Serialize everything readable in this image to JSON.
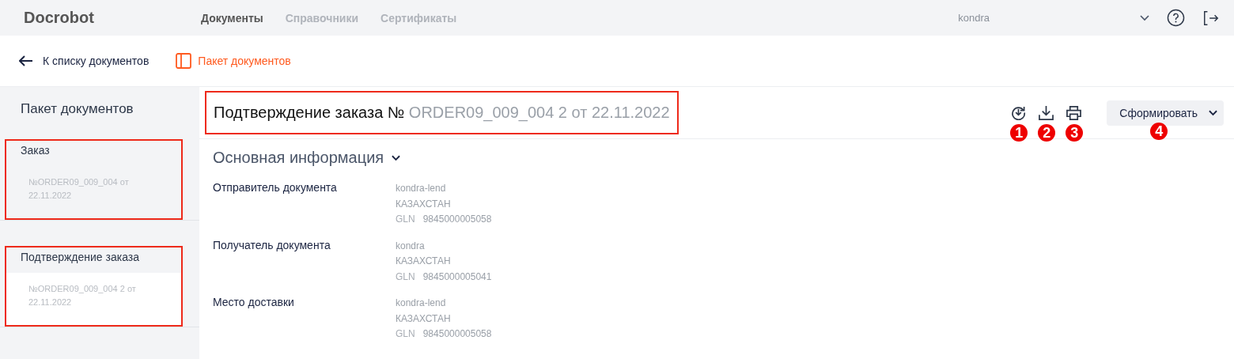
{
  "brand": {
    "name": "Docrobot"
  },
  "nav": [
    {
      "label": "Документы",
      "selected": true
    },
    {
      "label": "Справочники",
      "selected": false
    },
    {
      "label": "Сертификаты",
      "selected": false
    }
  ],
  "user": {
    "name": "kondra"
  },
  "subbar": {
    "back": "К списку документов",
    "package": "Пакет документов"
  },
  "sidebar": {
    "title": "Пакет документов",
    "items": [
      {
        "title": "Заказ",
        "subtitle": "№ORDER09_009_004 от 22.11.2022",
        "selected": false,
        "highlighted": true
      },
      {
        "title": "Подтверждение заказа",
        "subtitle": "№ORDER09_009_004 2 от 22.11.2022",
        "selected": true,
        "highlighted": true
      }
    ]
  },
  "document": {
    "title": "Подтверждение заказа №",
    "number": "ORDER09_009_004 2 от 22.11.2022",
    "highlighted": true
  },
  "actions": [
    {
      "kind": "refresh",
      "marker": "1"
    },
    {
      "kind": "download",
      "marker": "2"
    },
    {
      "kind": "print",
      "marker": "3"
    }
  ],
  "form_button": {
    "label": "Сформировать",
    "marker": "4"
  },
  "section": {
    "title": "Основная информация",
    "expanded": true
  },
  "fields": [
    {
      "label": "Отправитель документа",
      "name": "kondra-lend",
      "country": "КАЗАХСТАН",
      "gln_label": "GLN",
      "gln": "9845000005058"
    },
    {
      "label": "Получатель документа",
      "name": "kondra",
      "country": "КАЗАХСТАН",
      "gln_label": "GLN",
      "gln": "9845000005041"
    },
    {
      "label": "Место доставки",
      "name": "kondra-lend",
      "country": "КАЗАХСТАН",
      "gln_label": "GLN",
      "gln": "9845000005058"
    }
  ]
}
